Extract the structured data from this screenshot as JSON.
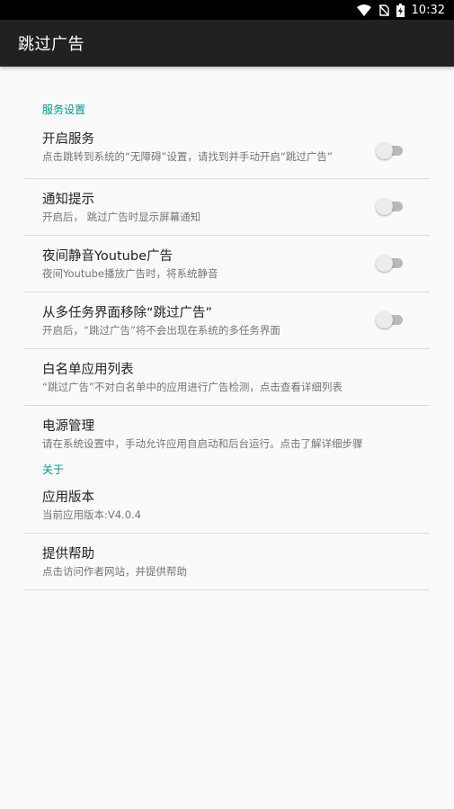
{
  "status_bar": {
    "time": "10:32",
    "icons": [
      "wifi-icon",
      "no-sim-icon",
      "battery-charging-icon"
    ]
  },
  "app_bar": {
    "title": "跳过广告"
  },
  "sections": [
    {
      "category": "服务设置",
      "items": [
        {
          "title": "开启服务",
          "summary": "点击跳转到系统的“无障碍”设置，请找到并手动开启“跳过广告”",
          "switch_on": false
        },
        {
          "title": "通知提示",
          "summary": "开启后， 跳过广告时显示屏幕通知",
          "switch_on": false
        },
        {
          "title": "夜间静音Youtube广告",
          "summary": "夜间Youtube播放广告时，将系统静音",
          "switch_on": false
        },
        {
          "title": "从多任务界面移除“跳过广告”",
          "summary": "开启后，“跳过广告”将不会出现在系统的多任务界面",
          "switch_on": false
        },
        {
          "title": "白名单应用列表",
          "summary": "“跳过广告”不对白名单中的应用进行广告检测，点击查看详细列表"
        },
        {
          "title": "电源管理",
          "summary": "请在系统设置中，手动允许应用自启动和后台运行。点击了解详细步骤"
        }
      ]
    },
    {
      "category": "关于",
      "items": [
        {
          "title": "应用版本",
          "summary": "当前应用版本:V4.0.4"
        },
        {
          "title": "提供帮助",
          "summary": "点击访问作者网站，并提供帮助"
        }
      ]
    }
  ],
  "colors": {
    "accent": "#009688",
    "app_bar": "#212121",
    "background": "#fafafa"
  }
}
